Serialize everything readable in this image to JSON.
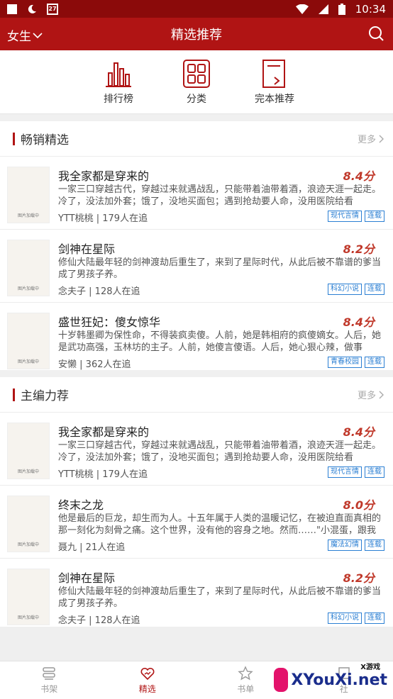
{
  "status_bar": {
    "time": "10:34",
    "calendar_day": "27"
  },
  "app_bar": {
    "gender": "女生",
    "title": "精选推荐"
  },
  "quick_nav": [
    {
      "label": "排行榜",
      "icon": "bar-chart-icon"
    },
    {
      "label": "分类",
      "icon": "grid-icon"
    },
    {
      "label": "完本推荐",
      "icon": "book-icon"
    }
  ],
  "sections": [
    {
      "title": "畅销精选",
      "more": "更多",
      "books": [
        {
          "title": "我全家都是穿来的",
          "score": "8.4分",
          "desc": "一家三口穿越古代，穿越过来就遇战乱，只能带着油带着酒，浪迹天涯一起走。冷了，没法加外套；饿了，没地买面包；遇到抢劫要人命，没用医院给看",
          "author": "YTT桃桃",
          "readers": "179人在追",
          "tags": [
            "现代言情",
            "连载"
          ],
          "cover_caption": "图片加载中"
        },
        {
          "title": "剑神在星际",
          "score": "8.2分",
          "desc": "修仙大陆最年轻的剑神渡劫后重生了，来到了星际时代，从此后被不靠谱的爹当成了男孩子养。",
          "author": "念夫子",
          "readers": "128人在追",
          "tags": [
            "科幻小说",
            "连载"
          ],
          "cover_caption": "图片加载中"
        },
        {
          "title": "盛世狂妃：傻女惊华",
          "score": "8.4分",
          "desc": "十岁韩墨卿为保性命，不得装疯卖傻。人前，她是韩相府的疯傻嫡女。人后，她是武功高强，玉林坊的主子。人前，她傻言傻语。人后，她心狠心辣，做事",
          "author": "安懒",
          "readers": "362人在追",
          "tags": [
            "青春校园",
            "连载"
          ],
          "cover_caption": "图片加载中"
        }
      ]
    },
    {
      "title": "主编力荐",
      "more": "更多",
      "books": [
        {
          "title": "我全家都是穿来的",
          "score": "8.4分",
          "desc": "一家三口穿越古代，穿越过来就遇战乱，只能带着油带着酒，浪迹天涯一起走。冷了，没法加外套；饿了，没地买面包；遇到抢劫要人命，没用医院给看",
          "author": "YTT桃桃",
          "readers": "179人在追",
          "tags": [
            "现代言情",
            "连载"
          ],
          "cover_caption": "图片加载中"
        },
        {
          "title": "终末之龙",
          "score": "8.0分",
          "desc": "他是最后的巨龙，却生而为人。十五年属于人类的温暖记忆，在被迫直面真相的那一刻化为刻骨之痛。这个世界，没有他的容身之地。然而……\"小混蛋，跟我",
          "author": "聂九",
          "readers": "21人在追",
          "tags": [
            "魔法幻情",
            "连载"
          ],
          "cover_caption": "图片加载中"
        },
        {
          "title": "剑神在星际",
          "score": "8.2分",
          "desc": "修仙大陆最年轻的剑神渡劫后重生了，来到了星际时代，从此后被不靠谱的爹当成了男孩子养。",
          "author": "念夫子",
          "readers": "128人在追",
          "tags": [
            "科幻小说",
            "连载"
          ],
          "cover_caption": "图片加载中"
        }
      ]
    }
  ],
  "tabs": [
    {
      "label": "书架",
      "icon": "bookshelf-icon"
    },
    {
      "label": "精选",
      "icon": "heart-icon",
      "active": true
    },
    {
      "label": "书单",
      "icon": "star-icon"
    },
    {
      "label": "社",
      "icon": "community-icon"
    }
  ],
  "watermark": {
    "small": "X游戏",
    "big": "XYouXi.net"
  },
  "colors": {
    "primary": "#b01414",
    "statusbar": "#8b0a0a",
    "score": "#c0392b",
    "tag": "#2b7fd3"
  }
}
